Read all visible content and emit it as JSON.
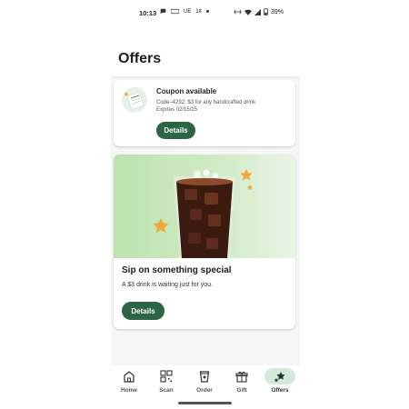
{
  "status_bar": {
    "time": "10:13",
    "left_icons": [
      "chat-icon",
      "sim-icon",
      "ue-icon",
      "temp-icon",
      "dot-icon"
    ],
    "left_text": [
      "UE",
      "1¢"
    ],
    "battery": "39%"
  },
  "page": {
    "title": "Offers"
  },
  "coupon": {
    "title": "Coupon available",
    "code": "Code–4292: $3 for any handcrafted drink",
    "expires": "Expires 02/15/25",
    "button_label": "Details"
  },
  "promo": {
    "title": "Sip on something special",
    "subtitle": "A $3 drink is waiting just for you.",
    "button_label": "Details"
  },
  "bottom_nav": {
    "items": [
      {
        "label": "Home",
        "icon": "home-icon"
      },
      {
        "label": "Scan",
        "icon": "qr-icon"
      },
      {
        "label": "Order",
        "icon": "cup-icon"
      },
      {
        "label": "Gift",
        "icon": "gift-icon"
      },
      {
        "label": "Offers",
        "icon": "stars-icon",
        "active": true
      }
    ]
  },
  "colors": {
    "brand_green": "#2c6546",
    "active_pill": "#d4e9d9",
    "banner_green": "#bde3b0",
    "star_gold": "#f2a93b"
  }
}
